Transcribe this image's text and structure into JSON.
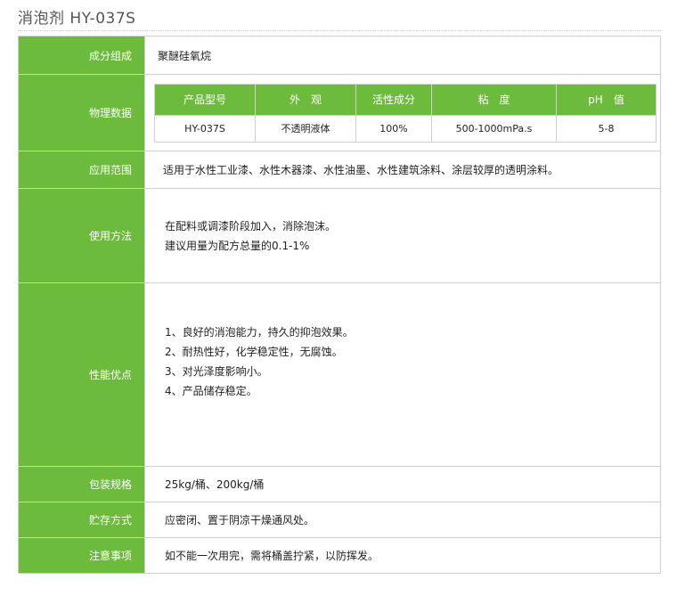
{
  "page": {
    "title": "消泡剂 HY-037S"
  },
  "labels": {
    "composition": "成分组成",
    "physical": "物理数据",
    "application": "应用范围",
    "usage": "使用方法",
    "performance": "性能优点",
    "packaging": "包装规格",
    "storage": "贮存方式",
    "notes": "注意事项"
  },
  "values": {
    "composition": "聚醚硅氧烷",
    "application": "适用于水性工业漆、水性木器漆、水性油墨、水性建筑涂料、涂层较厚的透明涂料。",
    "usage": [
      "在配料或调漆阶段加入，消除泡沫。",
      "建议用量为配方总量的0.1-1%"
    ],
    "performance": [
      "1、良好的消泡能力，持久的抑泡效果。",
      "2、耐热性好，化学稳定性，无腐蚀。",
      "3、对光泽度影响小。",
      "4、产品储存稳定。"
    ],
    "packaging": "25kg/桶、200kg/桶",
    "storage": "应密闭、置于阴凉干燥通风处。",
    "notes": "如不能一次用完，需将桶盖拧紧，以防挥发。"
  },
  "physical_table": {
    "headers": [
      "产品型号",
      "外　观",
      "活性成分",
      "粘　度",
      "pH　值"
    ],
    "row": [
      "HY-037S",
      "不透明液体",
      "100%",
      "500-1000mPa.s",
      "5-8"
    ]
  },
  "colors": {
    "accent_green": "#6cbb3c",
    "border": "#cfcfcf"
  }
}
